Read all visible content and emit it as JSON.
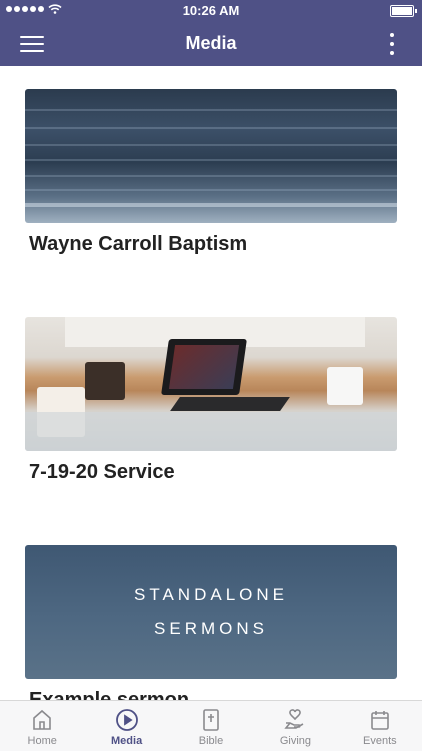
{
  "status_bar": {
    "time": "10:26 AM"
  },
  "header": {
    "title": "Media",
    "menu_icon": "hamburger-icon",
    "more_icon": "more-vertical-icon"
  },
  "cards": [
    {
      "title": "Wayne Carroll Baptism",
      "image": "ocean-water"
    },
    {
      "title": "7-19-20 Service",
      "image": "tablet-on-coffee-table"
    },
    {
      "title": "Example sermon",
      "image": "standalone-sermons-banner",
      "overlay_lines": [
        "STANDALONE",
        "SERMONS"
      ]
    }
  ],
  "tabbar": {
    "tabs": [
      {
        "label": "Home",
        "icon": "home-icon",
        "active": false
      },
      {
        "label": "Media",
        "icon": "play-circle-icon",
        "active": true
      },
      {
        "label": "Bible",
        "icon": "bible-icon",
        "active": false
      },
      {
        "label": "Giving",
        "icon": "giving-hand-icon",
        "active": false
      },
      {
        "label": "Events",
        "icon": "calendar-icon",
        "active": false
      }
    ],
    "active_color": "#4f5186",
    "inactive_color": "#8a8a8e"
  },
  "colors": {
    "brand": "#4f5186"
  }
}
